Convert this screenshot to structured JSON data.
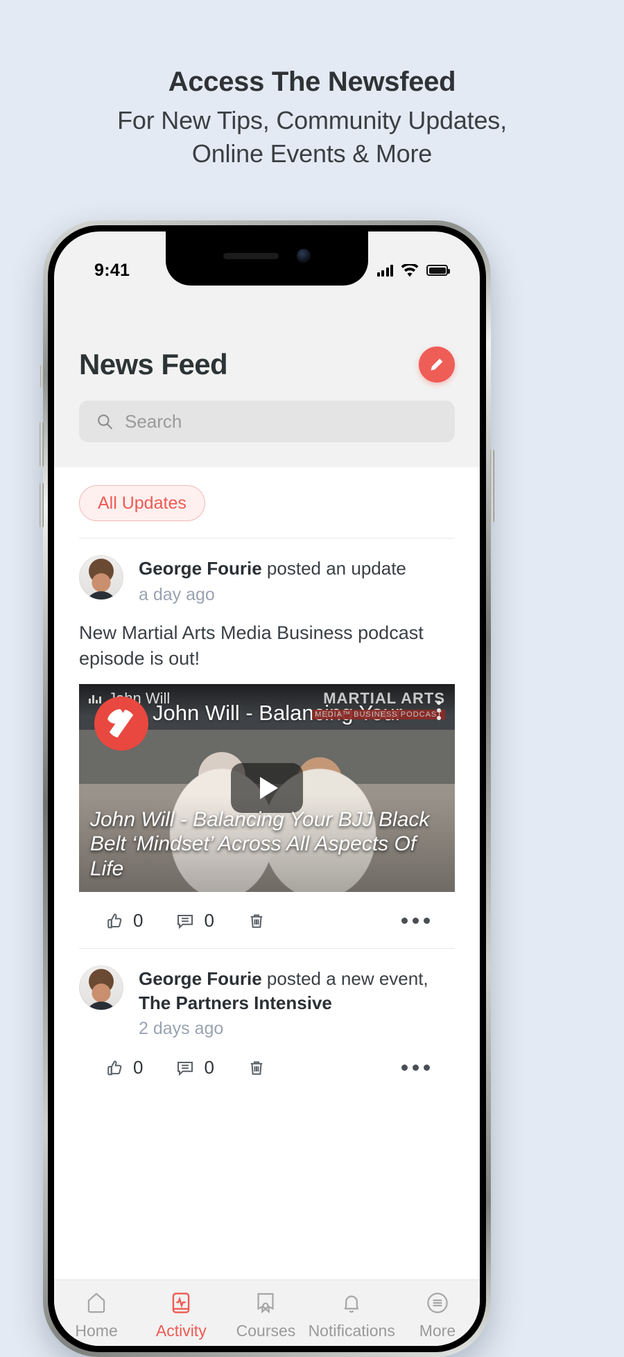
{
  "promo": {
    "headline": "Access The Newsfeed",
    "subheadline_line1": "For New Tips, Community Updates,",
    "subheadline_line2": "Online Events & More"
  },
  "status_bar": {
    "time": "9:41",
    "signal_icon": "cellular-bars-icon",
    "wifi_icon": "wifi-icon",
    "battery_icon": "battery-icon"
  },
  "header": {
    "title": "News Feed",
    "compose_icon": "pencil-icon",
    "accent_color": "#ef5d57"
  },
  "search": {
    "placeholder": "Search",
    "icon": "search-icon"
  },
  "filters": {
    "active": "All Updates"
  },
  "posts": [
    {
      "author": "George Fourie",
      "action": " posted an update",
      "time": "a day ago",
      "body": "New Martial Arts Media Business podcast episode is out!",
      "video": {
        "channel": "John Will",
        "title": "John Will - Balancing Your ...",
        "caption": "John Will - Balancing Your BJJ Black Belt ‘Mindset’ Across All Aspects Of Life",
        "brand_line1": "MARTIAL ARTS",
        "brand_line2": "MEDIA™ BUSINESS PODCAST",
        "play_icon": "play-button-icon",
        "kebab_icon": "more-vertical-icon"
      },
      "actions": {
        "like_count": "0",
        "comment_count": "0",
        "like_icon": "thumbs-up-icon",
        "comment_icon": "comment-icon",
        "delete_icon": "trash-icon",
        "more_icon": "more-horizontal-icon"
      }
    },
    {
      "author": "George Fourie",
      "action": " posted a new event, ",
      "event": "The Partners Intensive",
      "time": "2 days ago",
      "actions": {
        "like_count": "0",
        "comment_count": "0",
        "like_icon": "thumbs-up-icon",
        "comment_icon": "comment-icon",
        "delete_icon": "trash-icon",
        "more_icon": "more-horizontal-icon"
      }
    }
  ],
  "tabbar": {
    "items": [
      {
        "label": "Home",
        "icon": "home-icon",
        "active": false
      },
      {
        "label": "Activity",
        "icon": "activity-book-icon",
        "active": true
      },
      {
        "label": "Courses",
        "icon": "courses-icon",
        "active": false
      },
      {
        "label": "Notifications",
        "icon": "bell-icon",
        "active": false
      },
      {
        "label": "More",
        "icon": "menu-list-icon",
        "active": false
      }
    ]
  }
}
